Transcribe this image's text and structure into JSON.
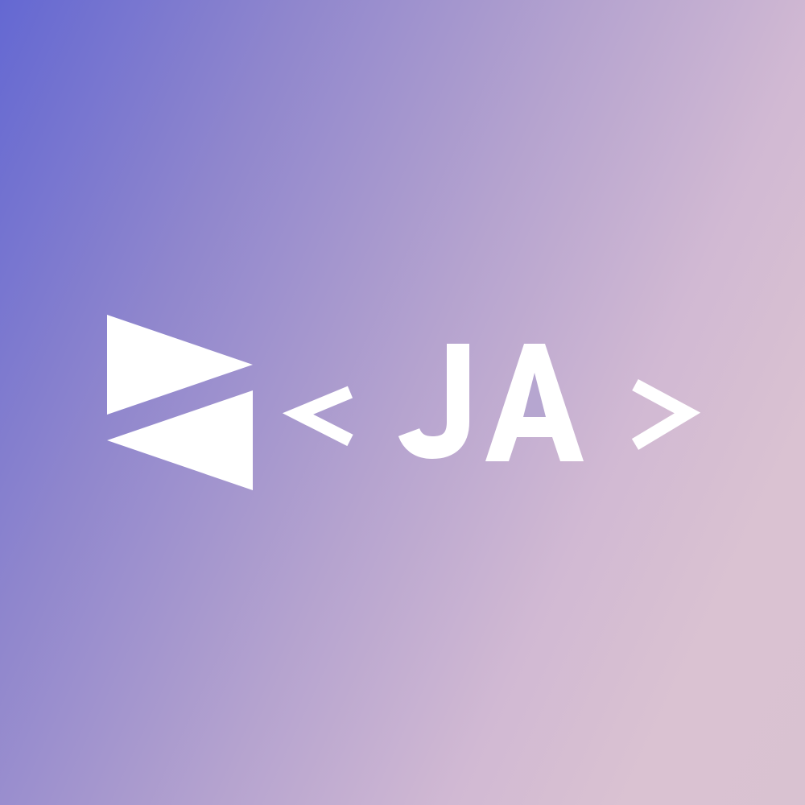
{
  "logo": {
    "wordmark": "< JA >",
    "bracket_open": "<",
    "initials": "JA",
    "bracket_close": ">",
    "mark_icon": "split-triangle-icon",
    "foreground_color": "#ffffff"
  },
  "background": {
    "gradient_start": "#6468d2",
    "gradient_end": "#dac2d2"
  }
}
